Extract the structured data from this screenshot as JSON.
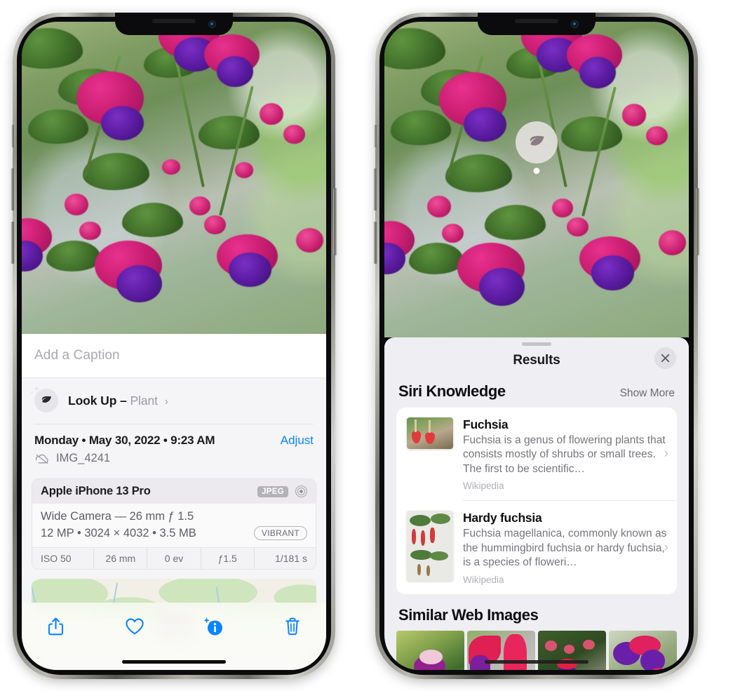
{
  "left_phone": {
    "caption": {
      "placeholder": "Add a Caption",
      "value": ""
    },
    "lookup": {
      "label": "Look Up –",
      "subject": "Plant",
      "chevron": "›",
      "icon": "leaf-icon",
      "sparkle_icon": "sparkles-icon"
    },
    "meta": {
      "date": "Monday • May 30, 2022 • 9:23 AM",
      "adjust_label": "Adjust",
      "filename": "IMG_4241",
      "cloud_icon": "cloud-slash-icon"
    },
    "camera_card": {
      "device": "Apple iPhone 13 Pro",
      "format_badge": "JPEG",
      "aperture_icon": "aperture-icon",
      "lens_line": "Wide Camera — 26 mm ƒ 1.5",
      "spec_line": "12 MP • 3024 × 4032 • 3.5 MB",
      "style_badge": "VIBRANT",
      "exif": [
        "ISO 50",
        "26 mm",
        "0 ev",
        "ƒ1.5",
        "1/181 s"
      ]
    },
    "map": {
      "pin_label": "photo-pin"
    },
    "toolbar": [
      {
        "name": "share-button",
        "icon": "share-icon"
      },
      {
        "name": "favorite-button",
        "icon": "heart-icon"
      },
      {
        "name": "info-button",
        "icon": "info-sparkle-icon"
      },
      {
        "name": "delete-button",
        "icon": "trash-icon"
      }
    ],
    "accent_color": "#0a84ff"
  },
  "right_phone": {
    "visual_lookup_badge": {
      "icon": "leaf-icon"
    },
    "results": {
      "title": "Results",
      "close_icon": "close-icon",
      "grabber": "drag-handle",
      "siri_knowledge": {
        "heading": "Siri Knowledge",
        "show_more": "Show More",
        "items": [
          {
            "title": "Fuchsia",
            "description": "Fuchsia is a genus of flowering plants that consists mostly of shrubs or small trees. The first to be scientific…",
            "source": "Wikipedia",
            "chevron": "›"
          },
          {
            "title": "Hardy fuchsia",
            "description": "Fuchsia magellanica, commonly known as the hummingbird fuchsia or hardy fuchsia, is a species of floweri…",
            "source": "Wikipedia",
            "chevron": "›"
          }
        ]
      },
      "similar_web_images": {
        "heading": "Similar Web Images",
        "count": 4
      }
    }
  }
}
